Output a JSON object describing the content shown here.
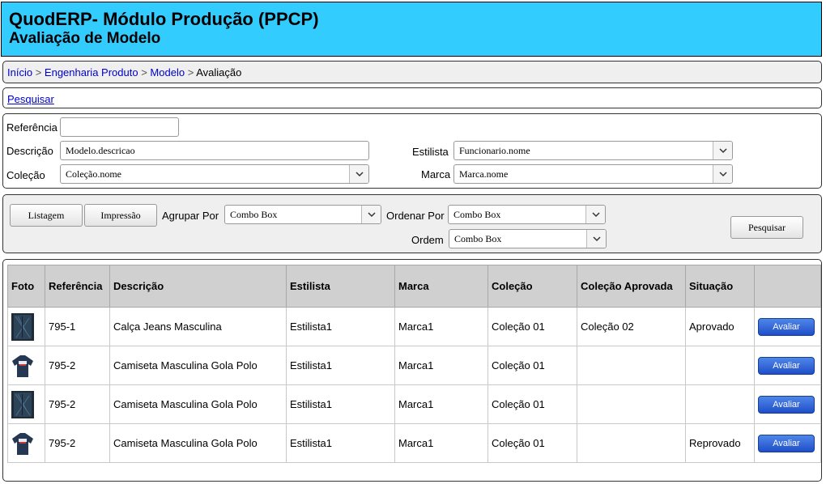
{
  "header": {
    "title": "QuodERP- Módulo Produção (PPCP)",
    "subtitle": "Avaliação de Modelo"
  },
  "breadcrumb": {
    "items": [
      "Início",
      "Engenharia Produto",
      "Modelo"
    ],
    "current": "Avaliação",
    "separator": ">"
  },
  "search_link": "Pesquisar",
  "filters": {
    "referencia_label": "Referência",
    "referencia_value": "",
    "descricao_label": "Descrição",
    "descricao_value": "Modelo.descricao",
    "colecao_label": "Coleção",
    "colecao_value": "Coleção.nome",
    "estilista_label": "Estilista",
    "estilista_value": "Funcionario.nome",
    "marca_label": "Marca",
    "marca_value": "Marca.nome"
  },
  "controls": {
    "listagem_label": "Listagem",
    "impressao_label": "Impressão",
    "agrupar_label": "Agrupar Por",
    "agrupar_value": "Combo Box",
    "ordenar_label": "Ordenar Por",
    "ordenar_value": "Combo Box",
    "ordem_label": "Ordem",
    "ordem_value": "Combo Box",
    "pesquisar_label": "Pesquisar"
  },
  "table": {
    "columns": [
      "Foto",
      "Referência",
      "Descrição",
      "Estilista",
      "Marca",
      "Coleção",
      "Coleção Aprovada",
      "Situação",
      ""
    ],
    "rows": [
      {
        "photo": "jeans-photo",
        "referencia": "795-1",
        "descricao": "Calça Jeans Masculina",
        "estilista": "Estilista1",
        "marca": "Marca1",
        "colecao": "Coleção 01",
        "colecao_aprovada": "Coleção 02",
        "situacao": "Aprovado",
        "action": "Avaliar"
      },
      {
        "photo": "tshirt-photo",
        "referencia": "795-2",
        "descricao": "Camiseta Masculina Gola Polo",
        "estilista": "Estilista1",
        "marca": "Marca1",
        "colecao": "Coleção 01",
        "colecao_aprovada": "",
        "situacao": "",
        "action": "Avaliar"
      },
      {
        "photo": "jeans-photo",
        "referencia": "795-2",
        "descricao": "Camiseta Masculina Gola Polo",
        "estilista": "Estilista1",
        "marca": "Marca1",
        "colecao": "Coleção 01",
        "colecao_aprovada": "",
        "situacao": "",
        "action": "Avaliar"
      },
      {
        "photo": "tshirt-photo",
        "referencia": "795-2",
        "descricao": "Camiseta Masculina Gola Polo",
        "estilista": "Estilista1",
        "marca": "Marca1",
        "colecao": "Coleção 01",
        "colecao_aprovada": "",
        "situacao": "Reprovado",
        "action": "Avaliar"
      }
    ]
  },
  "colors": {
    "header_bg": "#33ccff",
    "link": "#0000cc",
    "action_button": "#2f5fd8"
  }
}
